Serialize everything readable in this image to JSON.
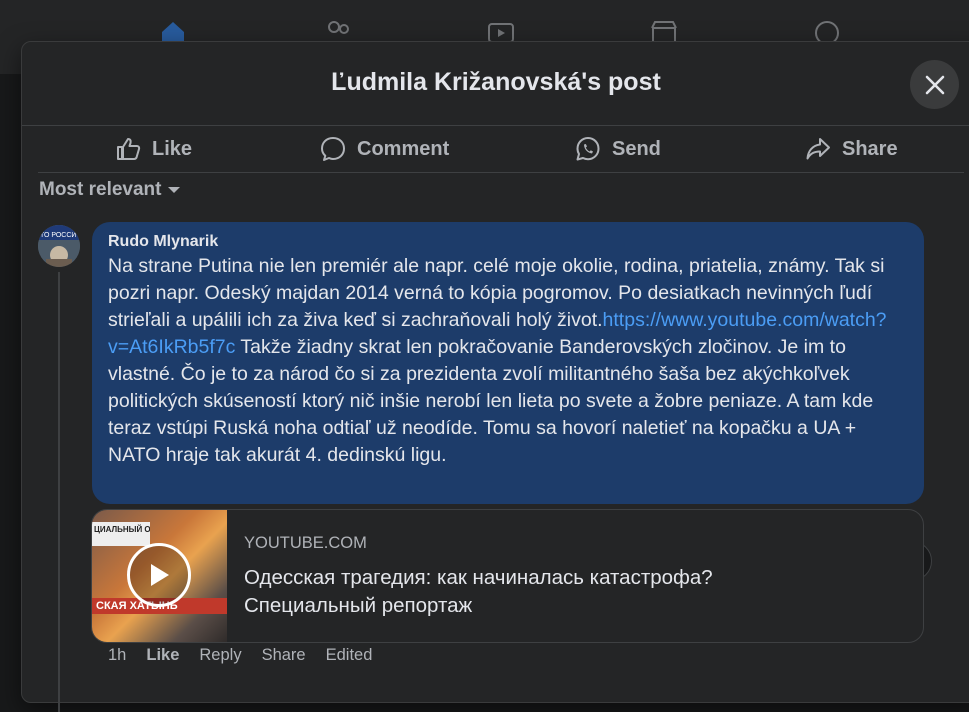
{
  "modal": {
    "title": "Ľudmila Križanovská's post"
  },
  "actions": {
    "like": "Like",
    "comment": "Comment",
    "send": "Send",
    "share": "Share"
  },
  "sort": {
    "label": "Most relevant"
  },
  "comment": {
    "author": "Rudo Mlynarik",
    "text_before": "Na strane Putina nie len premiér ale napr. celé moje okolie, rodina, priatelia, známy. Tak si pozri napr. Odeský majdan 2014 verná to kópia pogromov. Po desiatkach nevinných ľudí strieľali a upálili ich za živa keď si zachraňovali holý život.",
    "link": "https://www.youtube.com/watch?v=At6IkRb5f7c",
    "text_after": " Takže žiadny skrat len pokračovanie Banderovských zločinov. Je im to vlastné. Čo je to za národ čo si za prezidenta zvolí militantného šaša bez akýchkoľvek politických skúseností ktorý nič inšie nerobí len lieta po svete a žobre peniaze. A tam kde teraz vstúpi Ruská noha odtiaľ už neodíde. Tomu sa hovorí naletieť na kopačku a UA + NATO hraje tak akurát 4. dedinskú ligu.",
    "avatar_caption": "ТО РОССИ"
  },
  "preview": {
    "source": "YOUTUBE.COM",
    "title_line1": "Одесская трагедия: как начиналась катастрофа?",
    "title_line2": "Специальный репортаж",
    "thumb_top": "ЦИАЛЬНЫЙ ОРТАЖ",
    "thumb_bottom": "СКАЯ ХАТЫНЬ"
  },
  "meta": {
    "time": "1h",
    "like": "Like",
    "reply": "Reply",
    "share": "Share",
    "edited": "Edited"
  },
  "colors": {
    "background": "#18191a",
    "surface": "#242526",
    "bubble": "#1d3c6a",
    "link": "#4b9df5",
    "text": "#e4e6eb",
    "muted": "#b0b3b8"
  }
}
